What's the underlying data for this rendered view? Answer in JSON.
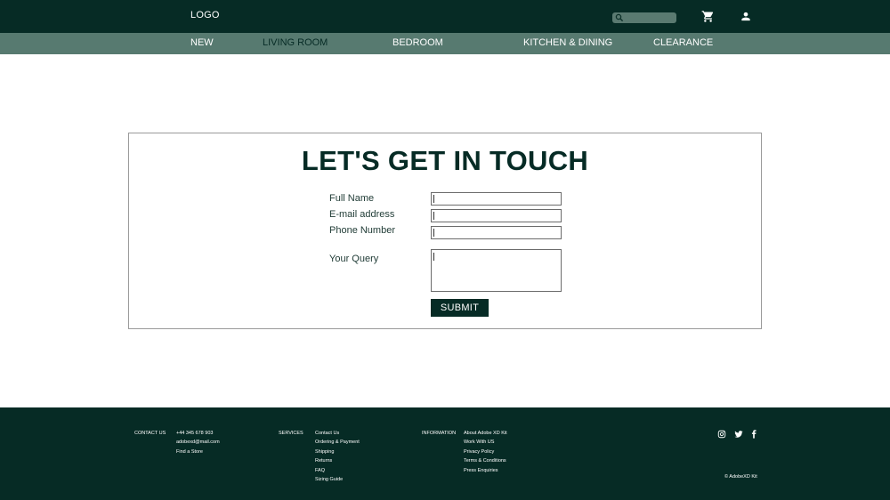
{
  "header": {
    "logo": "LOGO",
    "search_icon": "search-icon",
    "cart_icon": "cart-icon",
    "user_icon": "user-icon"
  },
  "nav": {
    "items": [
      {
        "label": "NEW"
      },
      {
        "label": "LIVING ROOM"
      },
      {
        "label": "BEDROOM"
      },
      {
        "label": "KITCHEN & DINING"
      },
      {
        "label": "CLEARANCE"
      }
    ],
    "active_index": 1
  },
  "contact": {
    "title": "LET'S GET IN TOUCH",
    "fields": [
      {
        "label": "Full Name",
        "value": ""
      },
      {
        "label": "E-mail address",
        "value": ""
      },
      {
        "label": "Phone Number",
        "value": ""
      }
    ],
    "query_label": "Your Query",
    "query_value": "",
    "submit_label": "SUBMIT"
  },
  "footer": {
    "contact_heading": "CONTACT US",
    "contact_items": [
      "+44 345 678 903",
      "adobexd@mail.com",
      "Find a Store"
    ],
    "services_heading": "SERVICES",
    "services_items": [
      "Contact Us",
      "Ordering & Payment",
      "Shipping",
      "Returns",
      "FAQ",
      "Sizing Guide"
    ],
    "information_heading": "INFORMATION",
    "information_items": [
      "About Adobe XD Kit",
      "Work With US",
      "Privacy Policy",
      "Terms & Conditions",
      "Press Enquiries"
    ],
    "social_icons": [
      "instagram-icon",
      "twitter-icon",
      "facebook-icon"
    ],
    "copyright": "© AdobeXD Kit"
  },
  "colors": {
    "dark_green": "#062b25",
    "nav_green": "#577a70",
    "search_bg": "#5a7a71"
  }
}
